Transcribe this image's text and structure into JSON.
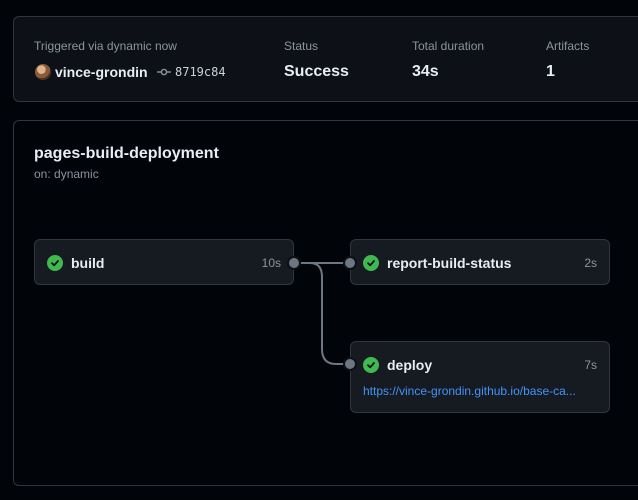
{
  "summary": {
    "trigger_label": "Triggered via dynamic now",
    "user": "vince-grondin",
    "commit_sha": "8719c84",
    "status_label": "Status",
    "status_value": "Success",
    "duration_label": "Total duration",
    "duration_value": "34s",
    "artifacts_label": "Artifacts",
    "artifacts_value": "1"
  },
  "workflow": {
    "title": "pages-build-deployment",
    "subtitle": "on: dynamic",
    "jobs": [
      {
        "name": "build",
        "duration": "10s"
      },
      {
        "name": "report-build-status",
        "duration": "2s"
      },
      {
        "name": "deploy",
        "duration": "7s",
        "link": "https://vince-grondin.github.io/base-ca..."
      }
    ]
  },
  "colors": {
    "background": "#010409",
    "card": "#0d1117",
    "border": "#30363d",
    "success": "#3fb950",
    "link": "#4493f8"
  },
  "icons": {
    "avatar": "user-avatar",
    "commit": "git-commit-icon",
    "job_status": "check-circle-icon"
  }
}
